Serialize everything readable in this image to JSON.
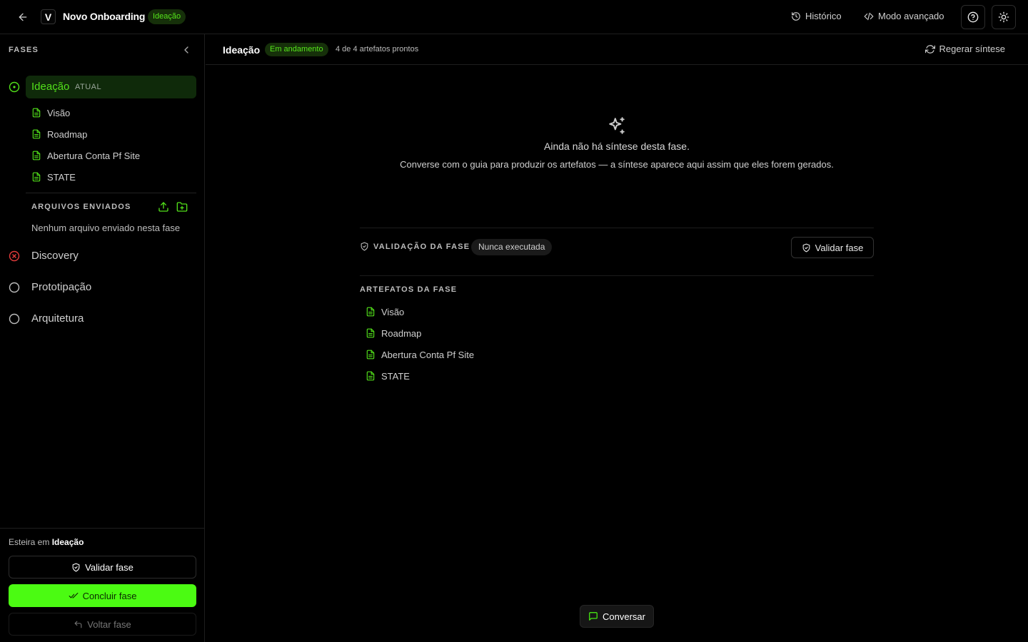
{
  "header": {
    "logo_letter": "V",
    "app_title": "Novo Onboarding",
    "phase_badge": "Ideação",
    "history_label": "Histórico",
    "advanced_label": "Modo avançado"
  },
  "sidebar": {
    "title": "FASES",
    "phases": [
      {
        "label": "Ideação",
        "tag": "ATUAL",
        "status": "current"
      },
      {
        "label": "Discovery",
        "status": "error"
      },
      {
        "label": "Prototipação",
        "status": "pending"
      },
      {
        "label": "Arquitetura",
        "status": "pending"
      }
    ],
    "current_artifacts": [
      "Visão",
      "Roadmap",
      "Abertura Conta Pf Site",
      "STATE"
    ],
    "files_title": "ARQUIVOS ENVIADOS",
    "files_empty": "Nenhum arquivo enviado nesta fase",
    "esteira_prefix": "Esteira em",
    "esteira_phase": "Ideação",
    "validate_label": "Validar fase",
    "conclude_label": "Concluir fase",
    "back_label": "Voltar fase"
  },
  "main": {
    "title": "Ideação",
    "status_badge": "Em andamento",
    "artifact_count": "4 de 4 artefatos prontos",
    "regen_label": "Regerar síntese",
    "empty_title": "Ainda não há síntese desta fase.",
    "empty_sub": "Converse com o guia para produzir os artefatos — a síntese aparece aqui assim que eles forem gerados.",
    "validation_title": "VALIDAÇÃO DA FASE",
    "validation_status": "Nunca executada",
    "validate_label": "Validar fase",
    "artifacts_title": "ARTEFATOS DA FASE",
    "artifacts": [
      "Visão",
      "Roadmap",
      "Abertura Conta Pf Site",
      "STATE"
    ],
    "chat_label": "Conversar"
  },
  "colors": {
    "accent": "#4bfb12",
    "accent_text": "#52e01a",
    "accent_bg": "#0f2a0a",
    "error": "#e23b3b",
    "background": "#000000"
  },
  "icons": {
    "back": "arrow-left-icon",
    "history": "history-icon",
    "code": "code-icon",
    "help": "help-circle-icon",
    "theme": "sun-icon",
    "collapse": "chevron-left-icon",
    "doc": "file-text-icon",
    "upload": "upload-icon",
    "folder": "folder-plus-icon",
    "sparkles": "sparkles-icon",
    "shield": "shield-check-icon",
    "check": "check-double-icon",
    "undo": "undo-icon",
    "chat": "message-square-icon",
    "refresh": "refresh-icon"
  }
}
